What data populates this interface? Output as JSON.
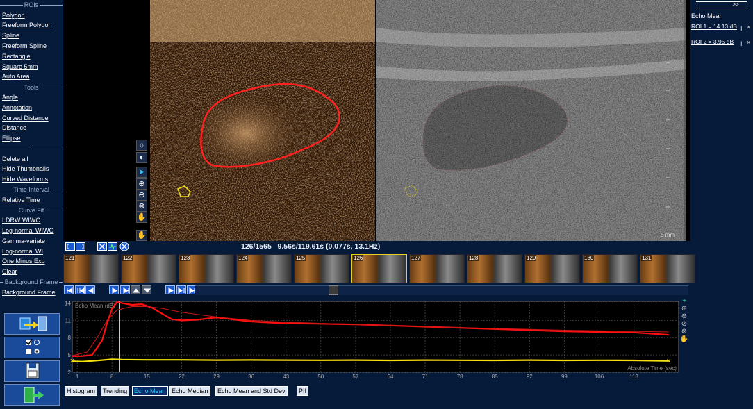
{
  "left_panel": {
    "sections": [
      {
        "title": "ROIs",
        "items": [
          "Polygon",
          "Freeform Polygon",
          "Spline",
          "Freeform Spline",
          "Rectangle",
          "Square 5mm",
          "Auto Area"
        ]
      },
      {
        "title": "Tools",
        "items": [
          "Angle",
          "Annotation",
          "Curved Distance",
          "Distance",
          "Ellipse"
        ]
      },
      {
        "title": "",
        "items": [
          "Delete all",
          "Hide Thumbnails",
          "Hide Waveforms"
        ]
      },
      {
        "title": "Time Interval",
        "items": [
          "Relative Time"
        ]
      },
      {
        "title": "Curve Fit",
        "items": [
          "LDRW WIWO",
          "Log-normal WIWO",
          "Gamma-variate",
          "Log-normal WI",
          "One Minus Exp",
          "Clear"
        ]
      },
      {
        "title": "Background Frame",
        "items": [
          "Background Frame"
        ]
      }
    ],
    "big_buttons": [
      "export-icon",
      "checkbox-options-icon",
      "save-disk-icon",
      "exit-door-icon"
    ]
  },
  "right_panel": {
    "collapse_glyph": ">>",
    "measure_title": "Echo Mean",
    "rois": [
      {
        "label": "ROI 1 = 14.13 dB",
        "color": "#ff2a2a"
      },
      {
        "label": "ROI 2 = 3.95 dB",
        "color": "#f0e020"
      }
    ],
    "action_glyphs": [
      "I",
      "×"
    ]
  },
  "image_area": {
    "scale_label": "5 mm",
    "tools": [
      "brightness-icon",
      "contrast-icon",
      "pointer-arrow-icon",
      "zoom-in-icon",
      "zoom-out-icon",
      "zoom-reset-icon",
      "pan-hand-icon",
      "hand-3d-icon"
    ]
  },
  "frame_info": "126/1565   9.56s/119.61s (0.077s, 13.1Hz)",
  "thumbnails": {
    "frames": [
      "121",
      "122",
      "123",
      "124",
      "125",
      "126",
      "127",
      "128",
      "129",
      "130",
      "131"
    ],
    "selected": "126"
  },
  "playback": {
    "buttons": [
      "first-frame-icon",
      "prev-marker-icon",
      "step-back-icon",
      "play-icon",
      "loop-icon",
      "up-icon",
      "down-icon",
      "step-forward-icon",
      "next-marker-icon",
      "last-frame-icon"
    ],
    "position": 0.28
  },
  "chart_data": {
    "type": "line",
    "ylabel": "Echo Mean (dB)",
    "xlabel": "Absolute Time (sec)",
    "xticks": [
      "1",
      "8",
      "15",
      "22",
      "29",
      "36",
      "43",
      "50",
      "57",
      "64",
      "71",
      "78",
      "85",
      "92",
      "99",
      "106",
      "113"
    ],
    "yticks": [
      "2",
      "5",
      "8",
      "11",
      "14"
    ],
    "xlim": [
      0,
      122
    ],
    "ylim": [
      2,
      14.3
    ],
    "cursor_x": 9.56,
    "series": [
      {
        "color": "#ff1010",
        "x": [
          0,
          2,
          4,
          6,
          7,
          8,
          9,
          10,
          12,
          14,
          16,
          18,
          20,
          22,
          25,
          29,
          33,
          36,
          40,
          43,
          50,
          57,
          64,
          71,
          78,
          85,
          92,
          99,
          106,
          113,
          120
        ],
        "y": [
          4.8,
          4.8,
          5.0,
          7.5,
          10.5,
          13.0,
          14.2,
          14.0,
          13.7,
          13.8,
          13.2,
          12.2,
          11.2,
          11.0,
          11.1,
          11.5,
          11.1,
          10.8,
          10.6,
          10.5,
          10.4,
          10.3,
          10.1,
          9.9,
          9.7,
          9.5,
          9.3,
          9.1,
          9.0,
          8.9,
          8.5
        ]
      },
      {
        "color": "#c81818",
        "x": [
          0,
          3,
          5,
          7,
          9,
          12,
          15,
          18,
          22,
          29,
          36,
          43,
          57,
          71,
          85,
          99,
          113,
          120
        ],
        "y": [
          4.9,
          5.5,
          8.0,
          11.0,
          12.8,
          13.4,
          13.4,
          13.1,
          12.4,
          11.6,
          11.0,
          10.7,
          10.3,
          9.9,
          9.6,
          9.3,
          9.1,
          9.0
        ]
      },
      {
        "color": "#f5e010",
        "x": [
          0,
          2,
          4,
          6,
          8,
          10,
          15,
          22,
          29,
          36,
          43,
          50,
          57,
          64,
          71,
          78,
          85,
          92,
          99,
          106,
          113,
          120
        ],
        "y": [
          3.9,
          3.85,
          3.95,
          4.1,
          4.25,
          4.2,
          4.15,
          4.15,
          4.1,
          4.12,
          4.1,
          4.08,
          4.1,
          4.05,
          4.1,
          4.08,
          4.05,
          4.1,
          4.05,
          4.08,
          4.05,
          3.95
        ]
      }
    ],
    "side_tools": [
      "plus-icon",
      "zoom-in-icon",
      "zoom-out-icon",
      "zoom-fit-icon",
      "zoom-reset-icon",
      "pan-hand-icon"
    ]
  },
  "tabs": [
    "Histogram",
    "Trending",
    "Echo Mean",
    "Echo Median",
    "Echo Mean and Std Dev",
    "PII"
  ],
  "active_tab": "Echo Mean"
}
